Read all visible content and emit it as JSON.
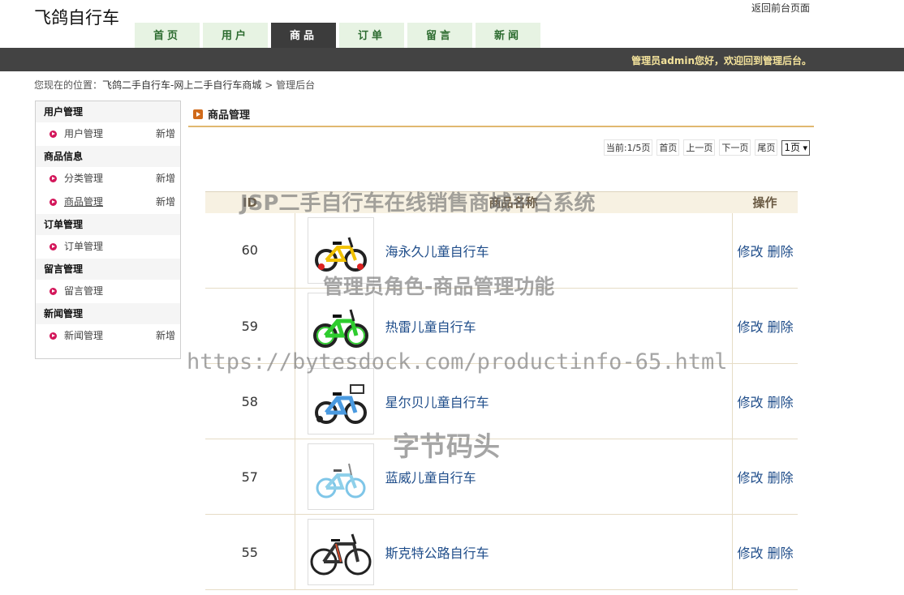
{
  "header": {
    "brand": "飞鸽自行车",
    "front_link": "返回前台页面",
    "welcome": "管理员admin您好，欢迎回到管理后台。"
  },
  "nav": {
    "tabs": [
      {
        "label": "首页",
        "active": false
      },
      {
        "label": "用户",
        "active": false
      },
      {
        "label": "商品",
        "active": true
      },
      {
        "label": "订单",
        "active": false
      },
      {
        "label": "留言",
        "active": false
      },
      {
        "label": "新闻",
        "active": false
      }
    ]
  },
  "breadcrumb": {
    "prefix": "您现在的位置：",
    "site": "飞鸽二手自行车-网上二手自行车商城",
    "separator": ">",
    "current": "管理后台"
  },
  "sidebar": {
    "sections": [
      {
        "title": "用户管理",
        "items": [
          {
            "label": "用户管理",
            "new": "新增"
          }
        ]
      },
      {
        "title": "商品信息",
        "items": [
          {
            "label": "分类管理",
            "new": "新增"
          },
          {
            "label": "商品管理",
            "new": "新增"
          }
        ]
      },
      {
        "title": "订单管理",
        "items": [
          {
            "label": "订单管理",
            "new": ""
          }
        ]
      },
      {
        "title": "留言管理",
        "items": [
          {
            "label": "留言管理",
            "new": ""
          }
        ]
      },
      {
        "title": "新闻管理",
        "items": [
          {
            "label": "新闻管理",
            "new": "新增"
          }
        ]
      }
    ]
  },
  "main": {
    "title": "商品管理",
    "pager": {
      "current": "当前:1/5页",
      "first": "首页",
      "prev": "上一页",
      "next": "下一页",
      "last": "尾页",
      "select": "1页"
    },
    "table": {
      "headers": [
        "ID",
        "商品名称",
        "操作"
      ],
      "rows": [
        {
          "id": "60",
          "name": "海永久儿童自行车",
          "edit": "修改",
          "delete": "删除"
        },
        {
          "id": "59",
          "name": "热雷儿童自行车",
          "edit": "修改",
          "delete": "删除"
        },
        {
          "id": "58",
          "name": "星尔贝儿童自行车",
          "edit": "修改",
          "delete": "删除"
        },
        {
          "id": "57",
          "name": "蓝威儿童自行车",
          "edit": "修改",
          "delete": "删除"
        },
        {
          "id": "55",
          "name": "斯克特公路自行车",
          "edit": "修改",
          "delete": "删除"
        }
      ]
    }
  },
  "watermarks": [
    "JSP二手自行车在线销售商城平台系统",
    "管理员角色-商品管理功能",
    "https://bytesdock.com/productinfo-65.html",
    "字节码头"
  ],
  "colors": {
    "topbar": "#434343",
    "active_tab": "#3c3c3c",
    "tab_bg": "#e7f3e3",
    "link": "#1f4d8a",
    "accent_rule": "#e0b870",
    "welcome": "#f3e29b"
  },
  "icons": [
    "bullet-arrow-icon",
    "section-arrow-icon",
    "bike-thumbnail"
  ]
}
